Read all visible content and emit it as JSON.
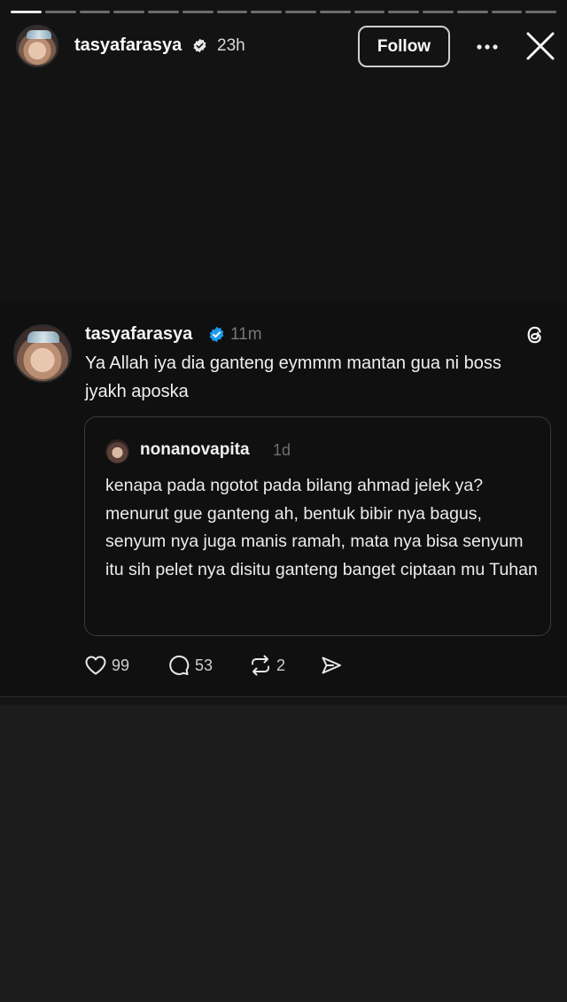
{
  "progress": {
    "total_segments": 16,
    "completed_segments": 1
  },
  "header": {
    "username": "tasyafarasya",
    "time": "23h",
    "follow_label": "Follow"
  },
  "post": {
    "username": "tasyafarasya",
    "time": "11m",
    "text": "Ya Allah iya dia ganteng eymmm mantan gua ni boss jyakh aposka",
    "quote": {
      "username": "nonanovapita",
      "time": "1d",
      "text": "kenapa pada ngotot pada bilang ahmad jelek ya? menurut gue ganteng ah, bentuk bibir nya bagus, senyum nya juga manis ramah, mata nya bisa senyum itu sih pelet nya disitu ganteng banget ciptaan mu Tuhan"
    },
    "stats": {
      "likes": "99",
      "replies": "53",
      "reposts": "2"
    }
  },
  "colors": {
    "verified": "#1d9bf0",
    "background": "#1c1c1c",
    "card": "#101010"
  },
  "icons": [
    "verified-badge-icon",
    "more-icon",
    "close-icon",
    "threads-icon",
    "heart-icon",
    "comment-icon",
    "repost-icon",
    "share-icon"
  ]
}
